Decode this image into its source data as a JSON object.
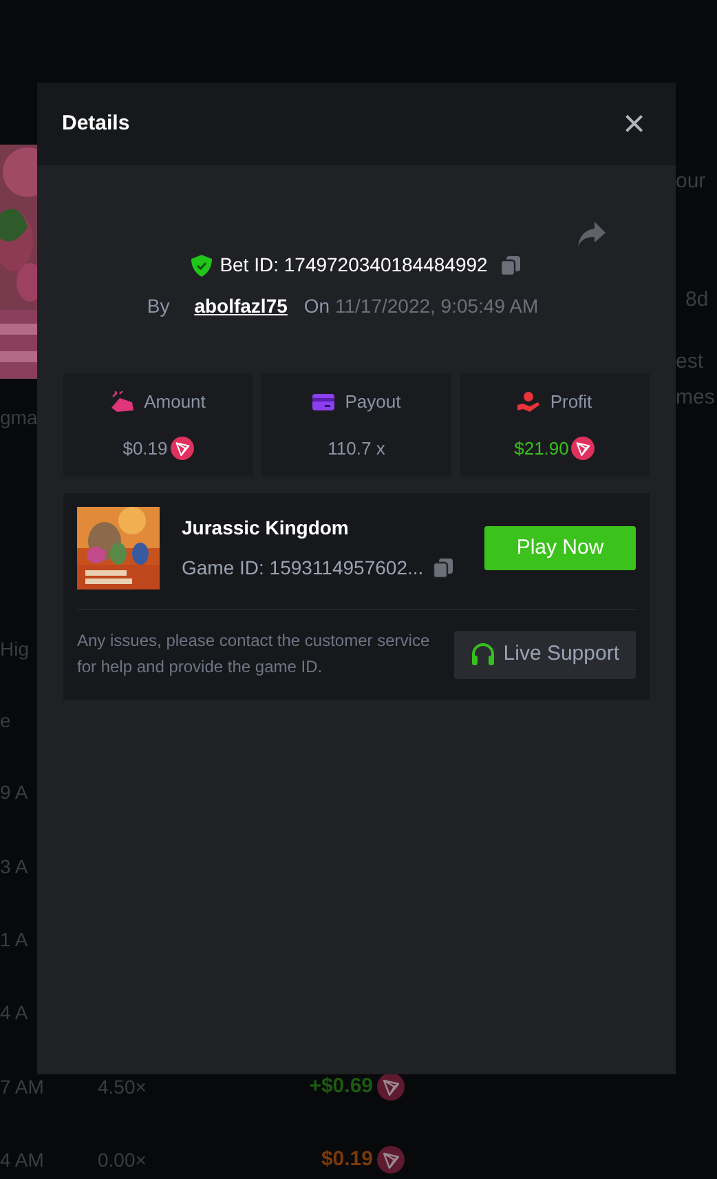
{
  "background": {
    "left_column": [
      "gma",
      "Hig",
      "e",
      "9 A",
      "3 A",
      "1 A",
      "4 A"
    ],
    "right_column": [
      "our",
      "8d",
      "est",
      "mes"
    ],
    "rows": [
      {
        "time": "7 AM",
        "multiplier": "4.50×",
        "amount": "+$0.69",
        "kind": "win"
      },
      {
        "time": "4 AM",
        "multiplier": "0.00×",
        "amount": "$0.19",
        "kind": "loss"
      }
    ]
  },
  "dialog": {
    "title": "Details",
    "close": "×",
    "bet": {
      "id_label": "Bet ID: 1749720340184484992",
      "by_label": "By",
      "user": "abolfazl75",
      "on_label": "On",
      "date": "11/17/2022, 9:05:49 AM"
    },
    "stats": [
      {
        "kind": "amount",
        "label": "Amount",
        "value": "$0.19"
      },
      {
        "kind": "payout",
        "label": "Payout",
        "value": "110.7 x"
      },
      {
        "kind": "profit",
        "label": "Profit",
        "value": "$21.90"
      }
    ],
    "game": {
      "title": "Jurassic Kingdom",
      "game_id": "Game ID: 1593114957602...",
      "play_button": "Play Now",
      "help_text": "Any issues, please contact the customer service for help and provide the game ID.",
      "support_button": "Live Support"
    }
  }
}
